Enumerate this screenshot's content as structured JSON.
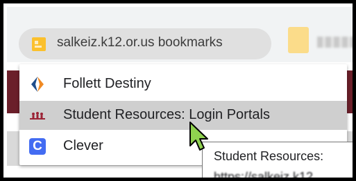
{
  "bookmark_bar": {
    "folder_label": "salkeiz.k12.or.us bookmarks",
    "folder_icon": "folder-icon"
  },
  "menu": {
    "items": [
      {
        "label": "Follett Destiny",
        "icon": "follett-destiny-icon"
      },
      {
        "label": "Student Resources: Login Portals",
        "icon": "student-resources-icon",
        "highlighted": true
      },
      {
        "label": "Clever",
        "icon": "clever-icon",
        "glyph": "C"
      }
    ]
  },
  "tooltip": {
    "title": "Student Resources:",
    "url": "https://salkeiz.k12"
  },
  "colors": {
    "highlight": "#cfcfcf",
    "clever_blue": "#436cf2",
    "cursor_green": "#8fd14f",
    "page_maroon": "#6b1f2a"
  }
}
